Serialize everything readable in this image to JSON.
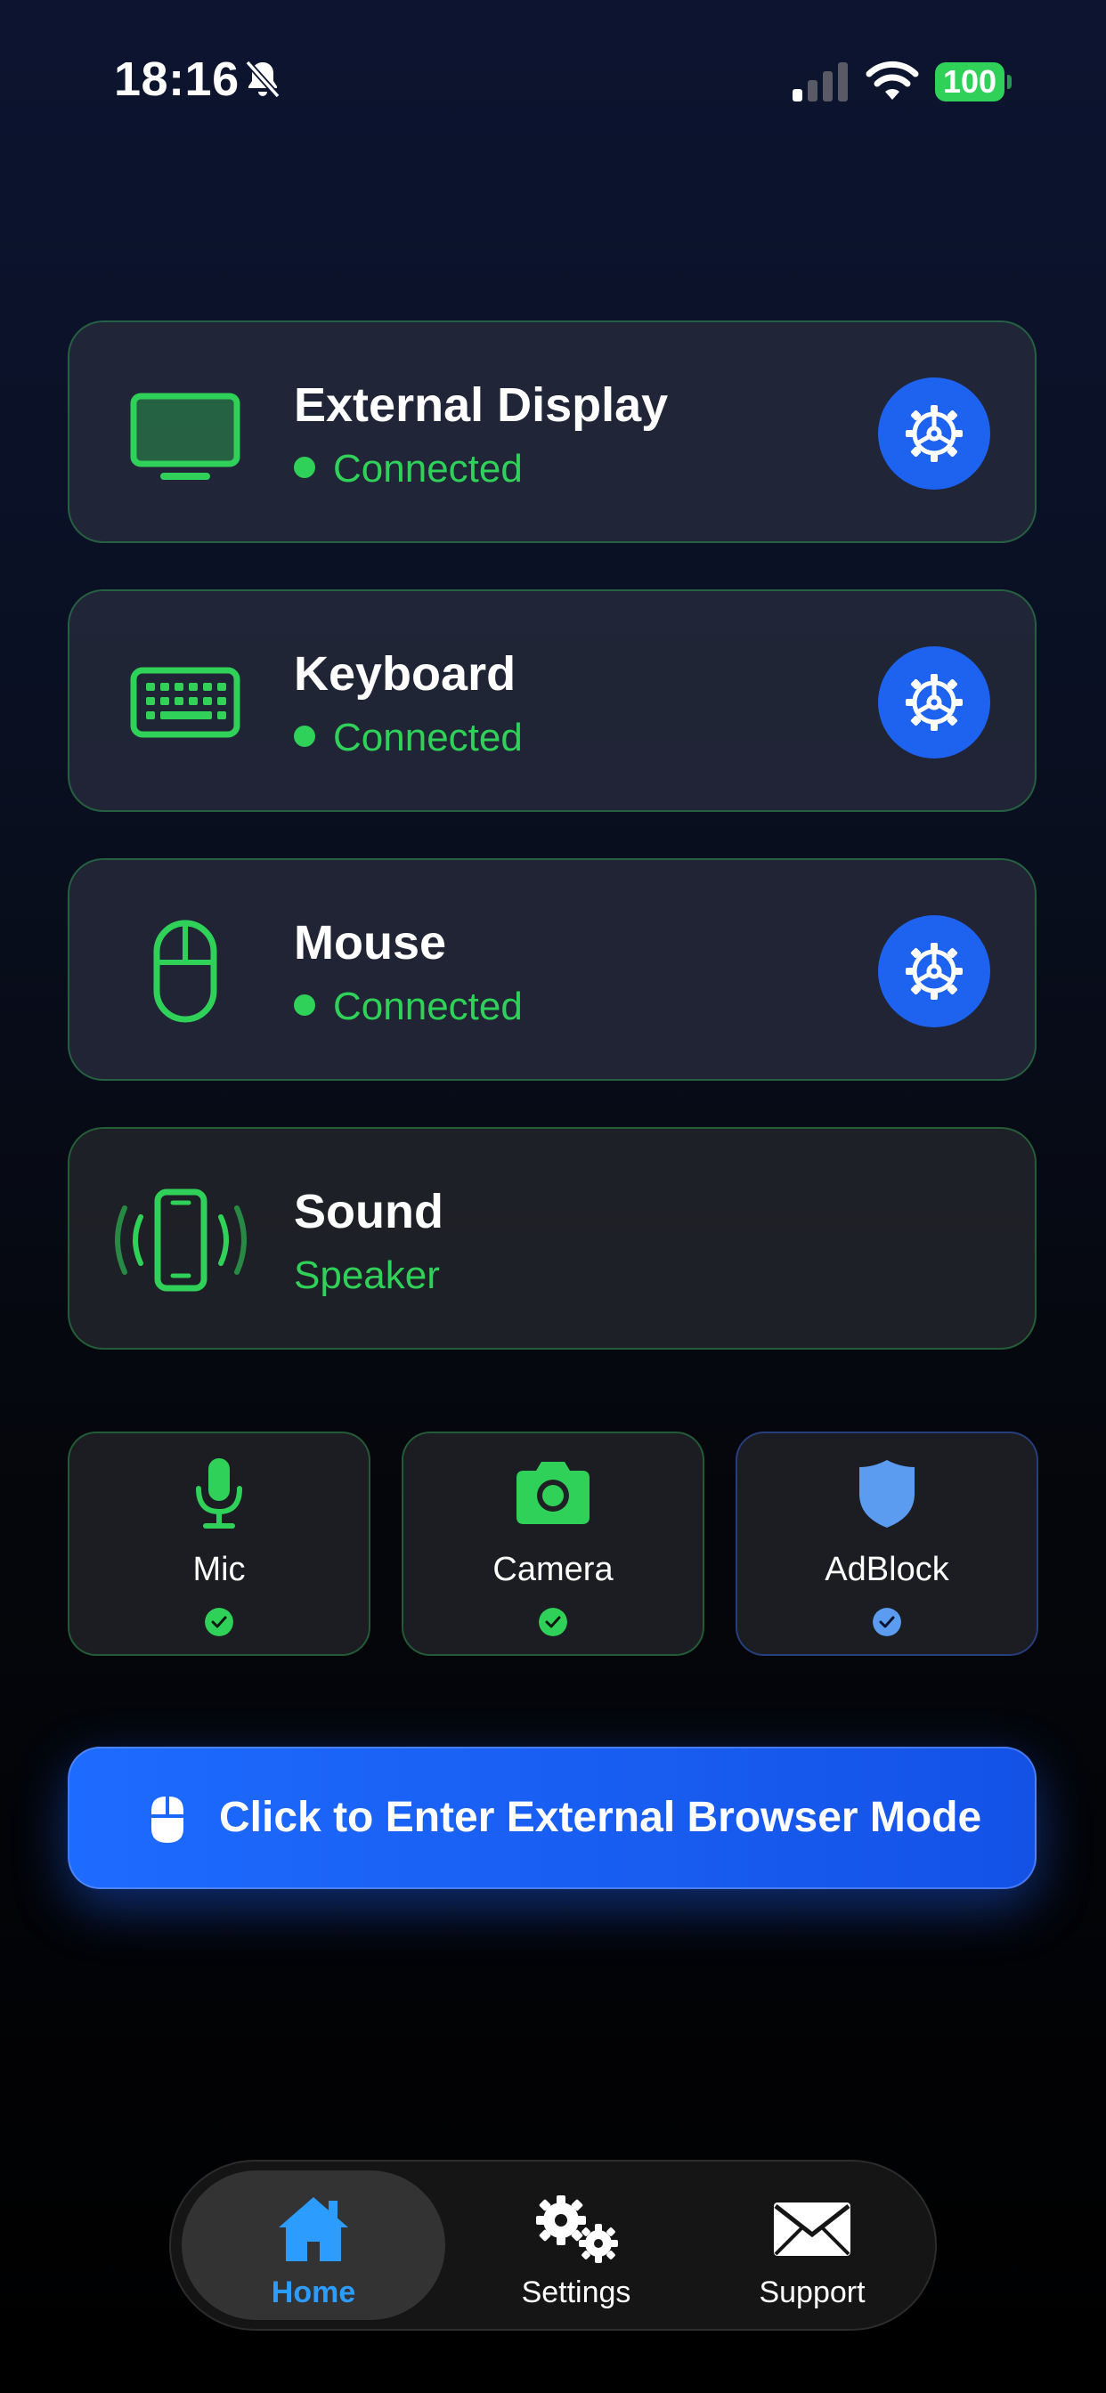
{
  "status_bar": {
    "time": "18:16",
    "battery": "100",
    "icons": [
      "bell-slash-icon",
      "cellular-signal-icon",
      "wifi-icon",
      "battery-icon"
    ]
  },
  "devices": [
    {
      "title": "External Display",
      "status": "Connected",
      "icon": "monitor-icon",
      "has_settings": true
    },
    {
      "title": "Keyboard",
      "status": "Connected",
      "icon": "keyboard-icon",
      "has_settings": true
    },
    {
      "title": "Mouse",
      "status": "Connected",
      "icon": "mouse-icon",
      "has_settings": true
    },
    {
      "title": "Sound",
      "status": "Speaker",
      "icon": "phone-speaker-icon",
      "has_settings": false
    }
  ],
  "tiles": [
    {
      "label": "Mic",
      "icon": "microphone-icon",
      "enabled": true
    },
    {
      "label": "Camera",
      "icon": "camera-icon",
      "enabled": true
    },
    {
      "label": "AdBlock",
      "icon": "shield-icon",
      "enabled": true
    }
  ],
  "cta": {
    "label": "Click to Enter External Browser Mode",
    "icon": "mouse-icon"
  },
  "tabbar": {
    "items": [
      {
        "label": "Home",
        "icon": "house-icon",
        "active": true
      },
      {
        "label": "Settings",
        "icon": "gears-icon",
        "active": false
      },
      {
        "label": "Support",
        "icon": "envelope-icon",
        "active": false
      }
    ]
  },
  "colors": {
    "accent_green": "#30d158",
    "accent_blue": "#1e62f0",
    "active_tab": "#2d9cff",
    "adblock_blue": "#5b9cf0"
  }
}
